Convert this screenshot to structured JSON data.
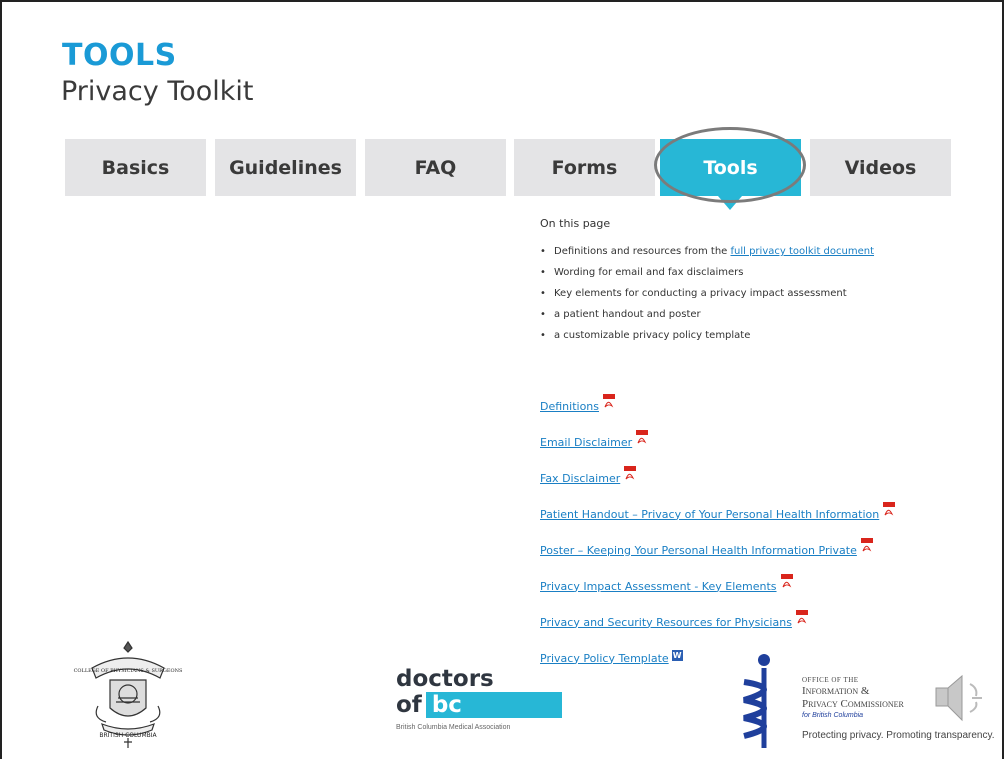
{
  "header": {
    "title": "TOOLS",
    "subtitle": "Privacy Toolkit"
  },
  "tabs": [
    {
      "label": "Basics",
      "active": false
    },
    {
      "label": "Guidelines",
      "active": false
    },
    {
      "label": "FAQ",
      "active": false
    },
    {
      "label": "Forms",
      "active": false
    },
    {
      "label": "Tools",
      "active": true
    },
    {
      "label": "Videos",
      "active": false
    }
  ],
  "content": {
    "heading": "On this page",
    "bullets": [
      {
        "text": "Definitions and resources from the ",
        "link": "full privacy toolkit document"
      },
      {
        "text": "Wording for email and fax disclaimers"
      },
      {
        "text": "Key elements for conducting a privacy impact assessment"
      },
      {
        "text": "a patient handout and poster"
      },
      {
        "text": "a customizable privacy policy template"
      }
    ],
    "documents": [
      {
        "label": "Definitions",
        "icon": "pdf-icon"
      },
      {
        "label": "Email Disclaimer",
        "icon": "pdf-icon"
      },
      {
        "label": "Fax Disclaimer",
        "icon": "pdf-icon"
      },
      {
        "label": "Patient Handout – Privacy of Your Personal Health Information",
        "icon": "pdf-icon"
      },
      {
        "label": "Poster – Keeping Your Personal Health Information Private",
        "icon": "pdf-icon"
      },
      {
        "label": "Privacy Impact Assessment - Key Elements",
        "icon": "pdf-icon"
      },
      {
        "label": "Privacy and Security Resources for Physicians",
        "icon": "pdf-icon"
      },
      {
        "label": "Privacy Policy Template",
        "icon": "word-icon"
      }
    ]
  },
  "logos": {
    "cps": {
      "bottom_text": "BRITISH COLUMBIA"
    },
    "doctors_bc": {
      "line1": "doctors",
      "of": "of",
      "bc": "bc",
      "tagline": "British Columbia Medical Association"
    },
    "oipc": {
      "line1": "Office of the",
      "line2": "Information &",
      "line3": "Privacy Commissioner",
      "line4": "for British Columbia",
      "tagline": "Protecting privacy. Promoting transparency."
    }
  },
  "colors": {
    "accent": "#27b7d6",
    "title": "#1a9ad6",
    "link": "#1a7fc4",
    "tab_bg": "#e4e4e6"
  }
}
